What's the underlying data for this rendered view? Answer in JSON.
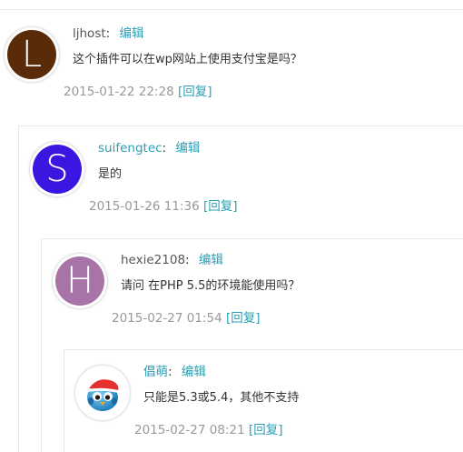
{
  "comments": [
    {
      "author": "ljhost",
      "author_sep": ":",
      "edit": "编辑",
      "text": "这个插件可以在wp网站上使用支付宝是吗？",
      "date": "2015-01-22 22:28",
      "reply": "[回复]",
      "avatar_letter": "L",
      "avatar_color": "#5a2b08"
    },
    {
      "author": "suifengtec",
      "author_sep": ":",
      "edit": "编辑",
      "text": "是的",
      "date": "2015-01-26 11:36",
      "reply": "[回复]",
      "avatar_letter": "S",
      "avatar_color": "#3a16e0"
    },
    {
      "author": "hexie2108",
      "author_sep": ":",
      "edit": "编辑",
      "text": "请问 在PHP 5.5的环境能使用吗？",
      "date": "2015-02-27 01:54",
      "reply": "[回复]",
      "avatar_letter": "H",
      "avatar_color": "#a874a8"
    },
    {
      "author": "倡萌",
      "author_sep": ":",
      "edit": "编辑",
      "text": "只能是5.3或5.4，其他不支持",
      "date": "2015-02-27 08:21",
      "reply": "[回复]",
      "avatar_icon": "blue-bird-santa-hat-icon"
    }
  ]
}
